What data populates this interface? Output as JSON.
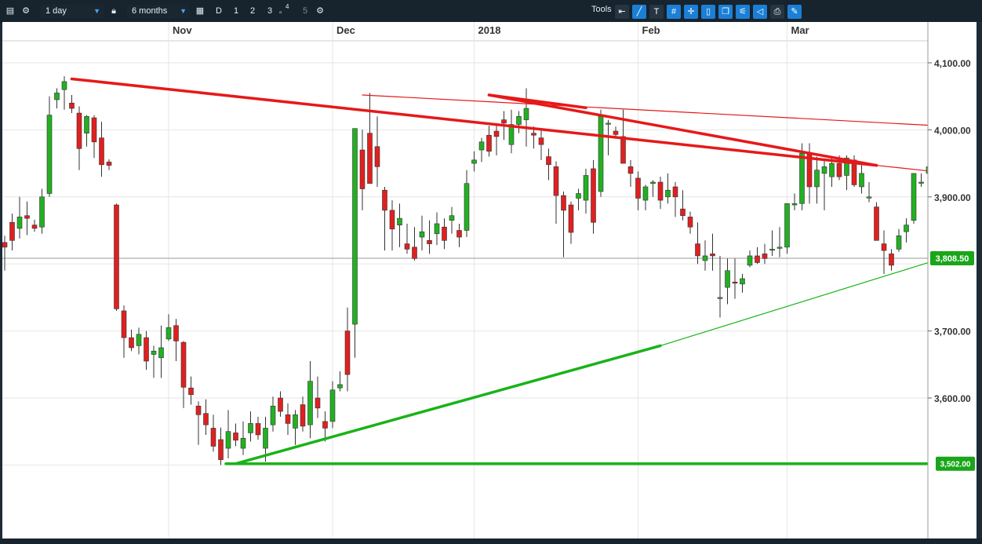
{
  "toolbar": {
    "interval": "1 day",
    "range": "6 months",
    "btn_d": "D",
    "btn_1": "1",
    "btn_2": "2",
    "btn_3": "3",
    "btn_4": "4",
    "btn_5": "5",
    "tools_label": "Tools"
  },
  "colors": {
    "up": "#22b022",
    "down": "#e02020",
    "resistance": "#e61919",
    "support": "#19b319",
    "price_badge": "#19a619"
  },
  "chart_data": {
    "type": "candlestick",
    "x_labels": [
      "Nov",
      "Dec",
      "2018",
      "Feb",
      "Mar"
    ],
    "y_ticks": [
      "4,100.00",
      "4,000.00",
      "3,900.00",
      "3,700.00",
      "3,600.00"
    ],
    "ylim": [
      3480,
      4130
    ],
    "grid": true,
    "current_price": "3,808.50",
    "support_level": "3,502.00",
    "candles": [
      [
        3832,
        3842,
        3790,
        3825
      ],
      [
        3862,
        3875,
        3820,
        3835
      ],
      [
        3853,
        3900,
        3838,
        3870
      ],
      [
        3872,
        3893,
        3843,
        3868
      ],
      [
        3858,
        3866,
        3848,
        3853
      ],
      [
        3855,
        3912,
        3845,
        3900
      ],
      [
        3905,
        4050,
        3900,
        4022
      ],
      [
        4045,
        4062,
        4032,
        4055
      ],
      [
        4060,
        4080,
        4030,
        4072
      ],
      [
        4040,
        4052,
        4025,
        4032
      ],
      [
        4025,
        4035,
        3940,
        3972
      ],
      [
        3995,
        4022,
        3975,
        4020
      ],
      [
        4018,
        4022,
        3958,
        3982
      ],
      [
        3988,
        4012,
        3930,
        3948
      ],
      [
        3952,
        3956,
        3940,
        3947
      ],
      [
        3888,
        3890,
        3730,
        3733
      ],
      [
        3730,
        3738,
        3660,
        3690
      ],
      [
        3690,
        3702,
        3670,
        3675
      ],
      [
        3678,
        3705,
        3665,
        3695
      ],
      [
        3690,
        3700,
        3642,
        3655
      ],
      [
        3665,
        3678,
        3630,
        3670
      ],
      [
        3660,
        3708,
        3630,
        3675
      ],
      [
        3688,
        3725,
        3685,
        3705
      ],
      [
        3708,
        3718,
        3655,
        3685
      ],
      [
        3683,
        3685,
        3585,
        3616
      ],
      [
        3615,
        3632,
        3590,
        3605
      ],
      [
        3588,
        3595,
        3530,
        3575
      ],
      [
        3577,
        3598,
        3545,
        3560
      ],
      [
        3555,
        3575,
        3520,
        3528
      ],
      [
        3538,
        3556,
        3500,
        3508
      ],
      [
        3525,
        3582,
        3510,
        3550
      ],
      [
        3548,
        3562,
        3528,
        3537
      ],
      [
        3525,
        3565,
        3515,
        3540
      ],
      [
        3548,
        3580,
        3535,
        3562
      ],
      [
        3562,
        3572,
        3538,
        3545
      ],
      [
        3525,
        3572,
        3505,
        3555
      ],
      [
        3560,
        3602,
        3550,
        3588
      ],
      [
        3600,
        3610,
        3572,
        3580
      ],
      [
        3575,
        3592,
        3545,
        3562
      ],
      [
        3555,
        3582,
        3530,
        3575
      ],
      [
        3590,
        3602,
        3550,
        3558
      ],
      [
        3560,
        3655,
        3540,
        3625
      ],
      [
        3600,
        3632,
        3570,
        3585
      ],
      [
        3565,
        3580,
        3535,
        3555
      ],
      [
        3565,
        3625,
        3555,
        3612
      ],
      [
        3615,
        3640,
        3610,
        3620
      ],
      [
        3700,
        3735,
        3610,
        3635
      ],
      [
        3710,
        3852,
        3660,
        4002
      ],
      [
        3970,
        4000,
        3880,
        3912
      ],
      [
        3995,
        4055,
        3935,
        3920
      ],
      [
        3975,
        4020,
        3915,
        3945
      ],
      [
        3910,
        3915,
        3820,
        3880
      ],
      [
        3880,
        3895,
        3820,
        3852
      ],
      [
        3858,
        3890,
        3825,
        3868
      ],
      [
        3830,
        3860,
        3815,
        3822
      ],
      [
        3825,
        3855,
        3805,
        3808
      ],
      [
        3840,
        3872,
        3820,
        3848
      ],
      [
        3835,
        3865,
        3815,
        3830
      ],
      [
        3845,
        3877,
        3828,
        3860
      ],
      [
        3855,
        3868,
        3822,
        3835
      ],
      [
        3865,
        3885,
        3845,
        3872
      ],
      [
        3850,
        3860,
        3825,
        3840
      ],
      [
        3850,
        3940,
        3840,
        3920
      ],
      [
        3950,
        3968,
        3938,
        3955
      ],
      [
        3970,
        3988,
        3952,
        3982
      ],
      [
        3992,
        4006,
        3960,
        3968
      ],
      [
        3998,
        4010,
        3962,
        3990
      ],
      [
        4015,
        4028,
        3985,
        4010
      ],
      [
        3978,
        4030,
        3965,
        4008
      ],
      [
        4008,
        4028,
        3995,
        4020
      ],
      [
        4015,
        4062,
        3975,
        4032
      ],
      [
        3995,
        4005,
        3972,
        3992
      ],
      [
        3988,
        4002,
        3955,
        3978
      ],
      [
        3960,
        3972,
        3925,
        3948
      ],
      [
        3945,
        3953,
        3860,
        3902
      ],
      [
        3902,
        3908,
        3810,
        3880
      ],
      [
        3888,
        3893,
        3830,
        3847
      ],
      [
        3898,
        3912,
        3880,
        3905
      ],
      [
        3895,
        3942,
        3875,
        3932
      ],
      [
        3942,
        3955,
        3845,
        3862
      ],
      [
        3908,
        4030,
        3900,
        4020
      ],
      [
        4010,
        4015,
        3962,
        4010
      ],
      [
        3998,
        4005,
        3990,
        3993
      ],
      [
        3990,
        4030,
        3962,
        3950
      ],
      [
        3945,
        3955,
        3915,
        3935
      ],
      [
        3928,
        3938,
        3880,
        3898
      ],
      [
        3895,
        3918,
        3880,
        3915
      ],
      [
        3920,
        3925,
        3900,
        3922
      ],
      [
        3922,
        3930,
        3882,
        3895
      ],
      [
        3900,
        3935,
        3890,
        3910
      ],
      [
        3915,
        3922,
        3870,
        3900
      ],
      [
        3882,
        3910,
        3865,
        3872
      ],
      [
        3870,
        3878,
        3845,
        3855
      ],
      [
        3830,
        3862,
        3800,
        3812
      ],
      [
        3805,
        3835,
        3790,
        3812
      ],
      [
        3815,
        3845,
        3790,
        3812
      ],
      [
        3750,
        3812,
        3720,
        3750
      ],
      [
        3765,
        3808,
        3740,
        3790
      ],
      [
        3773,
        3808,
        3748,
        3772
      ],
      [
        3770,
        3785,
        3757,
        3778
      ],
      [
        3798,
        3820,
        3795,
        3812
      ],
      [
        3812,
        3825,
        3800,
        3802
      ],
      [
        3815,
        3830,
        3800,
        3808
      ],
      [
        3822,
        3850,
        3812,
        3822
      ],
      [
        3825,
        3855,
        3810,
        3825
      ],
      [
        3825,
        3890,
        3815,
        3890
      ],
      [
        3888,
        3905,
        3880,
        3890
      ],
      [
        3890,
        3980,
        3880,
        3965
      ],
      [
        3965,
        3980,
        3890,
        3915
      ],
      [
        3915,
        3960,
        3890,
        3940
      ],
      [
        3935,
        3955,
        3880,
        3945
      ],
      [
        3930,
        3958,
        3915,
        3950
      ],
      [
        3950,
        3962,
        3925,
        3930
      ],
      [
        3932,
        3962,
        3910,
        3958
      ],
      [
        3955,
        3962,
        3915,
        3918
      ],
      [
        3915,
        3948,
        3905,
        3935
      ],
      [
        3900,
        3922,
        3892,
        3900
      ],
      [
        3885,
        3892,
        3835,
        3835
      ],
      [
        3830,
        3850,
        3785,
        3820
      ],
      [
        3815,
        3822,
        3790,
        3798
      ],
      [
        3822,
        3852,
        3818,
        3842
      ],
      [
        3848,
        3868,
        3832,
        3858
      ],
      [
        3865,
        3920,
        3860,
        3935
      ],
      [
        3922,
        3935,
        3915,
        3922
      ],
      [
        3935,
        3950,
        3925,
        3945
      ],
      [
        3935,
        3948,
        3862,
        3872
      ],
      [
        3858,
        3890,
        3828,
        3830
      ],
      [
        3832,
        3842,
        3810,
        3825
      ],
      [
        3820,
        3830,
        3798,
        3808
      ],
      [
        3798,
        3812,
        3790,
        3808
      ]
    ],
    "trendlines": [
      {
        "kind": "resistance",
        "from": [
          9,
          4076
        ],
        "to": [
          117,
          3947
        ],
        "width": "thick"
      },
      {
        "kind": "resistance",
        "from": [
          48,
          4052
        ],
        "to": [
          117,
          4011
        ],
        "width": "thin"
      },
      {
        "kind": "resistance",
        "from": [
          65,
          4052
        ],
        "to": [
          78,
          4033
        ],
        "width": "thick"
      },
      {
        "kind": "resistance",
        "from": [
          65,
          4052
        ],
        "to": [
          78,
          4033
        ],
        "width": "thick",
        "extend_to": [
          117,
          3947
        ]
      },
      {
        "kind": "support",
        "from": [
          31,
          3502
        ],
        "to": [
          88,
          3678
        ],
        "width": "thick"
      },
      {
        "kind": "support",
        "from": [
          88,
          3678
        ],
        "to": [
          117,
          3778
        ],
        "width": "thin"
      },
      {
        "kind": "support",
        "from": [
          30,
          3502
        ],
        "to": [
          122,
          3502
        ],
        "width": "thick",
        "horizontal": true
      }
    ],
    "x_label_positions": [
      22,
      44,
      63,
      85,
      105
    ]
  }
}
